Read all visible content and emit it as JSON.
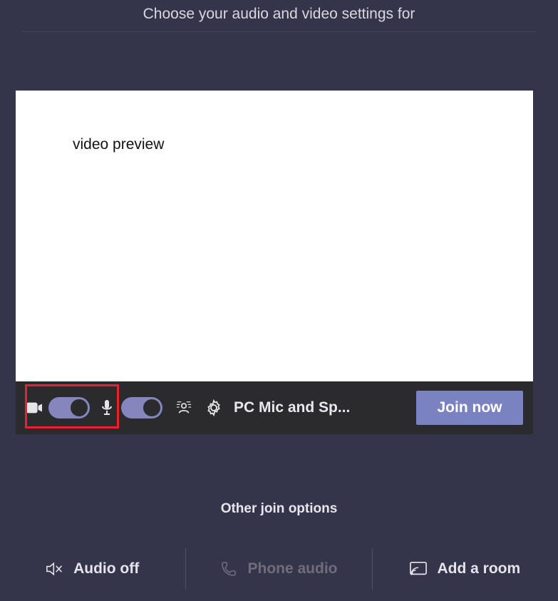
{
  "header": {
    "title": "Choose your audio and video settings for"
  },
  "preview": {
    "label": "video preview"
  },
  "controls": {
    "camera_toggle_on": true,
    "mic_toggle_on": true,
    "device_label": "PC Mic and Sp...",
    "join_label": "Join now"
  },
  "other": {
    "title": "Other join options",
    "options": [
      {
        "label": "Audio off",
        "icon": "speaker-muted-icon",
        "enabled": true
      },
      {
        "label": "Phone audio",
        "icon": "phone-icon",
        "enabled": false
      },
      {
        "label": "Add a room",
        "icon": "cast-icon",
        "enabled": true
      }
    ]
  }
}
